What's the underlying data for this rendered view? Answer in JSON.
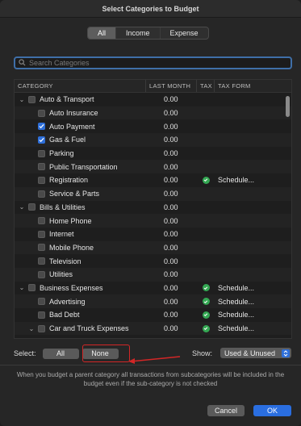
{
  "window": {
    "title": "Select Categories to Budget"
  },
  "filter_tabs": [
    {
      "label": "All",
      "active": true
    },
    {
      "label": "Income",
      "active": false
    },
    {
      "label": "Expense",
      "active": false
    }
  ],
  "search": {
    "placeholder": "Search Categories",
    "value": ""
  },
  "table": {
    "columns": [
      "CATEGORY",
      "LAST MONTH",
      "TAX",
      "TAX FORM"
    ],
    "rows": [
      {
        "name": "Auto & Transport",
        "level": 0,
        "expanded": true,
        "checked": false,
        "last_month": "0.00",
        "tax": false,
        "tax_form": ""
      },
      {
        "name": "Auto Insurance",
        "level": 1,
        "checked": false,
        "last_month": "0.00",
        "tax": false,
        "tax_form": ""
      },
      {
        "name": "Auto Payment",
        "level": 1,
        "checked": true,
        "last_month": "0.00",
        "tax": false,
        "tax_form": ""
      },
      {
        "name": "Gas & Fuel",
        "level": 1,
        "checked": true,
        "last_month": "0.00",
        "tax": false,
        "tax_form": ""
      },
      {
        "name": "Parking",
        "level": 1,
        "checked": false,
        "last_month": "0.00",
        "tax": false,
        "tax_form": ""
      },
      {
        "name": "Public Transportation",
        "level": 1,
        "checked": false,
        "last_month": "0.00",
        "tax": false,
        "tax_form": ""
      },
      {
        "name": "Registration",
        "level": 1,
        "checked": false,
        "last_month": "0.00",
        "tax": true,
        "tax_form": "Schedule..."
      },
      {
        "name": "Service & Parts",
        "level": 1,
        "checked": false,
        "last_month": "0.00",
        "tax": false,
        "tax_form": ""
      },
      {
        "name": "Bills & Utilities",
        "level": 0,
        "expanded": true,
        "checked": false,
        "last_month": "0.00",
        "tax": false,
        "tax_form": ""
      },
      {
        "name": "Home Phone",
        "level": 1,
        "checked": false,
        "last_month": "0.00",
        "tax": false,
        "tax_form": ""
      },
      {
        "name": "Internet",
        "level": 1,
        "checked": false,
        "last_month": "0.00",
        "tax": false,
        "tax_form": ""
      },
      {
        "name": "Mobile Phone",
        "level": 1,
        "checked": false,
        "last_month": "0.00",
        "tax": false,
        "tax_form": ""
      },
      {
        "name": "Television",
        "level": 1,
        "checked": false,
        "last_month": "0.00",
        "tax": false,
        "tax_form": ""
      },
      {
        "name": "Utilities",
        "level": 1,
        "checked": false,
        "last_month": "0.00",
        "tax": false,
        "tax_form": ""
      },
      {
        "name": "Business Expenses",
        "level": 0,
        "expanded": true,
        "checked": false,
        "last_month": "0.00",
        "tax": true,
        "tax_form": "Schedule..."
      },
      {
        "name": "Advertising",
        "level": 1,
        "checked": false,
        "last_month": "0.00",
        "tax": true,
        "tax_form": "Schedule..."
      },
      {
        "name": "Bad Debt",
        "level": 1,
        "checked": false,
        "last_month": "0.00",
        "tax": true,
        "tax_form": "Schedule..."
      },
      {
        "name": "Car and Truck Expenses",
        "level": 1,
        "expandable": true,
        "expanded": true,
        "checked": false,
        "last_month": "0.00",
        "tax": true,
        "tax_form": "Schedule..."
      }
    ]
  },
  "selection": {
    "label": "Select:",
    "all_label": "All",
    "none_label": "None"
  },
  "show": {
    "label": "Show:",
    "value": "Used & Unused"
  },
  "note": "When you budget a parent category all transactions from subcategories will be included in the budget even if the sub-category is not checked",
  "actions": {
    "cancel_label": "Cancel",
    "ok_label": "OK"
  },
  "colors": {
    "accent": "#2a6ee0",
    "tax_ok": "#34a853",
    "highlight": "#d32626"
  }
}
